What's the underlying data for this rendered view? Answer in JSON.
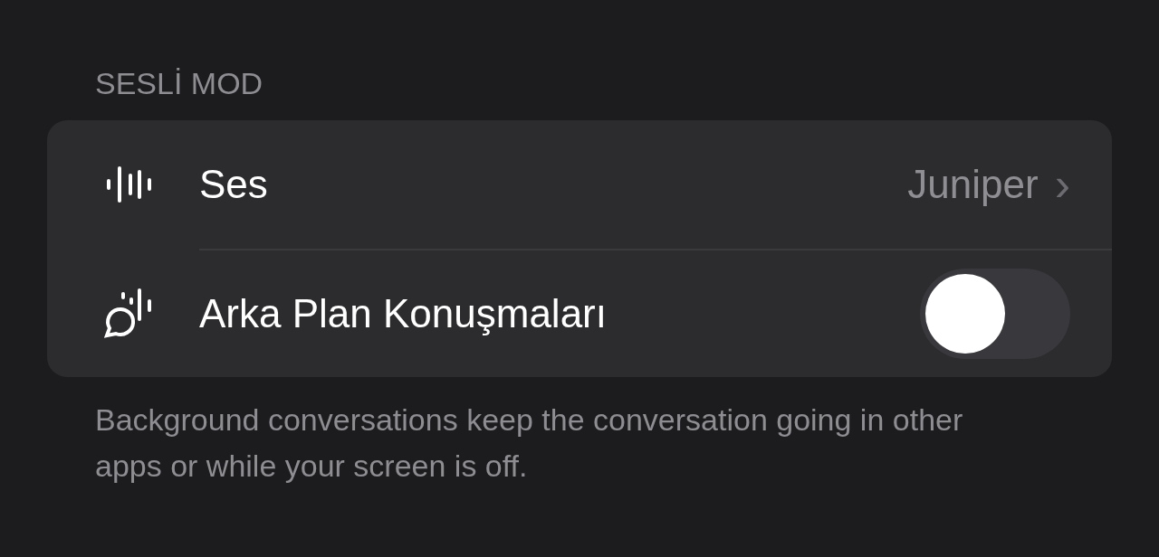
{
  "section_header": "SESLİ MOD",
  "rows": [
    {
      "kind": "link",
      "label": "Ses",
      "value": "Juniper",
      "chevron": "›"
    },
    {
      "kind": "toggle",
      "label": "Arka Plan Konuşmaları",
      "on": false
    }
  ],
  "footer": "Background conversations keep the conversation going in other apps or while your screen is off."
}
